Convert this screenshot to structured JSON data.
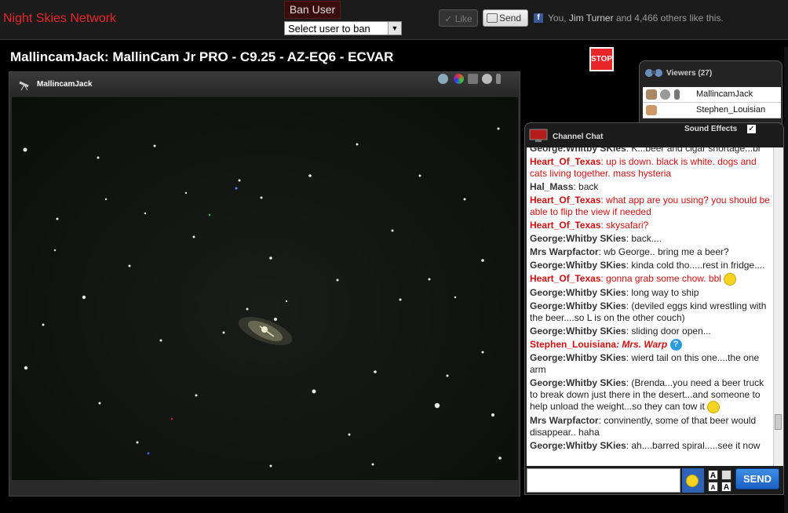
{
  "site": {
    "title": "Night Skies Network"
  },
  "ban": {
    "button_label": "Ban User",
    "select_value": "Select user to ban"
  },
  "social": {
    "like_label": "Like",
    "send_label": "Send",
    "like_prefix": "You, ",
    "like_name": "Jim Turner",
    "like_suffix": " and 4,466 others like this."
  },
  "stream": {
    "title": "MallincamJack: MallinCam Jr PRO - C9.25 - AZ-EQ6 - ECVAR",
    "stop_label": "STOP"
  },
  "video": {
    "camera_name": "MallincamJack"
  },
  "viewers": {
    "title": "Viewers (27)",
    "items": [
      {
        "name": "MallincamJack"
      },
      {
        "name": "Stephen_Louisian"
      }
    ]
  },
  "chat": {
    "title": "Channel Chat",
    "sound_effects_label": "Sound Effects",
    "messages": [
      {
        "user": "George:Whitby SKies",
        "text": ": K...beer and cigar shortage...br"
      },
      {
        "user": "Heart_Of_Texas",
        "text": ": up is down. black is white. dogs and cats living together. mass hysteria"
      },
      {
        "user": "Hal_Mass",
        "text": ": back"
      },
      {
        "user": "Heart_Of_Texas",
        "text": ": what app are you using? you should be able to flip the view if needed"
      },
      {
        "user": "Heart_Of_Texas",
        "text": ": skysafari?"
      },
      {
        "user": "George:Whitby SKies",
        "text": ": back...."
      },
      {
        "user": "Mrs Warpfactor",
        "text": ": wb George.. bring me a beer?"
      },
      {
        "user": "George:Whitby SKies",
        "text": ": kinda cold tho.....rest in fridge...."
      },
      {
        "user": "Heart_Of_Texas",
        "text": ": gonna grab some chow. bbl"
      },
      {
        "user": "George:Whitby SKies",
        "text": ": long way to ship"
      },
      {
        "user": "George:Whitby SKies",
        "text": ": (deviled eggs kind wrestling with the beer....so L is on the other couch)"
      },
      {
        "user": "George:Whitby SKies",
        "text": ": sliding door open..."
      },
      {
        "user": "Stephen_Louisiana",
        "text": ": Mrs. Warp"
      },
      {
        "user": "George:Whitby SKies",
        "text": ": wierd tail on this one....the one arm"
      },
      {
        "user": "George:Whitby SKies",
        "text": ": (Brenda...you need a beer truck to break down just there in the desert...and someone to help unload the weight...so they can tow it"
      },
      {
        "user": "Mrs Warpfactor",
        "text": ": convinently, some of that beer would disappear.. haha"
      },
      {
        "user": "George:Whitby SKies",
        "text": ": ah....barred spiral.....see it now"
      }
    ],
    "send_label": "SEND",
    "format_a": "A"
  }
}
